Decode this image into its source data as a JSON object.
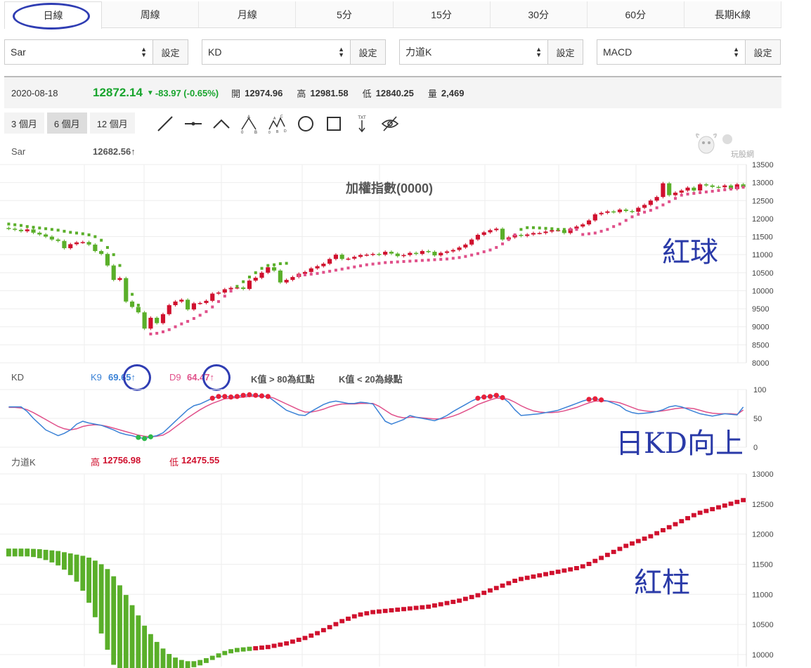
{
  "tabs": [
    "日線",
    "周線",
    "月線",
    "5分",
    "15分",
    "30分",
    "60分",
    "長期K線"
  ],
  "selectors": [
    {
      "value": "Sar",
      "button": "設定"
    },
    {
      "value": "KD",
      "button": "設定"
    },
    {
      "value": "力道K",
      "button": "設定"
    },
    {
      "value": "MACD",
      "button": "設定"
    }
  ],
  "info": {
    "date": "2020-08-18",
    "price": "12872.14",
    "change": "-83.97 (-0.65%)",
    "open_label": "開",
    "open": "12974.96",
    "high_label": "高",
    "high": "12981.58",
    "low_label": "低",
    "low": "12840.25",
    "vol_label": "量",
    "vol": "2,469",
    "down_color": "#19a52e"
  },
  "ranges": [
    "3 個月",
    "6 個月",
    "12 個月"
  ],
  "tools": [
    "line-tool-icon",
    "segment-tool-icon",
    "angle-tool-icon",
    "abc-pattern-icon",
    "abcd-pattern-icon",
    "circle-tool-icon",
    "rectangle-tool-icon",
    "text-tool-icon",
    "hide-icon"
  ],
  "watermark": "玩股網",
  "sar_panel": {
    "name": "Sar",
    "value": "12682.56↑",
    "title": "加權指數(0000)",
    "annotation": "紅球"
  },
  "kd_panel": {
    "name": "KD",
    "k_label": "K9",
    "k_value": "69.65↑",
    "d_label": "D9",
    "d_value": "64.47↑",
    "note1": "K值 > 80為紅點",
    "note2": "K值 < 20為綠點",
    "annotation": "日KD向上"
  },
  "force_panel": {
    "name": "力道K",
    "high_label": "高",
    "high": "12756.98",
    "low_label": "低",
    "low": "12475.55",
    "annotation": "紅柱"
  },
  "colors": {
    "up": "#d0102e",
    "down": "#5aaf2a",
    "k_line": "#3b82d6",
    "d_line": "#e0508a",
    "annotation": "#2a3aa8"
  },
  "chart_data": [
    {
      "type": "candlestick",
      "title": "加權指數(0000)",
      "ylim": [
        8000,
        13500
      ],
      "yticks": [
        13500,
        13000,
        12500,
        12000,
        11500,
        11000,
        10500,
        10000,
        9500,
        9000,
        8500,
        8000
      ],
      "closes": [
        11720,
        11690,
        11650,
        11700,
        11610,
        11560,
        11500,
        11420,
        11380,
        11180,
        11290,
        11340,
        11350,
        11280,
        11100,
        11020,
        10700,
        10300,
        10350,
        9700,
        9550,
        9400,
        8950,
        9250,
        9100,
        9350,
        9600,
        9700,
        9750,
        9480,
        9650,
        9660,
        9720,
        9920,
        9950,
        10040,
        10080,
        10090,
        10050,
        10280,
        10360,
        10500,
        10650,
        10560,
        10230,
        10300,
        10380,
        10470,
        10520,
        10620,
        10680,
        10750,
        10880,
        11000,
        10880,
        10890,
        10940,
        10990,
        11000,
        11020,
        11000,
        11080,
        11030,
        10960,
        10990,
        11050,
        11020,
        11100,
        11080,
        10980,
        11050,
        11090,
        11130,
        11200,
        11280,
        11420,
        11550,
        11620,
        11680,
        11720,
        11420,
        11480,
        11550,
        11520,
        11560,
        11600,
        11600,
        11640,
        11680,
        11680,
        11600,
        11720,
        11780,
        11840,
        11950,
        12120,
        12160,
        12200,
        12180,
        12250,
        12210,
        12190,
        12300,
        12380,
        12500,
        12600,
        12980,
        12650,
        12720,
        12780,
        12860,
        12780,
        12950,
        12920,
        12880,
        12870,
        12920,
        12820,
        12950,
        12872
      ],
      "sar": [
        11850,
        11830,
        11810,
        11780,
        11760,
        11740,
        11720,
        11700,
        11680,
        11650,
        11620,
        11600,
        11580,
        11550,
        11500,
        11400,
        11200,
        11000,
        10700,
        10300,
        9900,
        9600,
        null,
        8800,
        8820,
        8860,
        8920,
        9000,
        9080,
        9150,
        9230,
        9320,
        9420,
        9550,
        9700,
        9850,
        9990,
        10120,
        10250,
        10380,
        10500,
        10620,
        10700,
        10720,
        10750,
        10760,
        null,
        10420,
        10440,
        10460,
        10480,
        10510,
        10540,
        10570,
        10600,
        10630,
        10660,
        10690,
        10720,
        10740,
        10760,
        10780,
        10790,
        10800,
        10810,
        10820,
        10830,
        10840,
        10850,
        10860,
        10870,
        10880,
        10900,
        10920,
        10950,
        10990,
        11030,
        11080,
        11130,
        11200,
        11300,
        11420,
        11550,
        11700,
        11750,
        11750,
        11740,
        11730,
        11720,
        11700,
        11700,
        11700,
        11700,
        11560,
        11580,
        11600,
        11650,
        11700,
        11780,
        11850,
        11950,
        12050,
        12120,
        12180,
        12230,
        12300,
        12380,
        12470,
        12560,
        12650,
        12680,
        12700,
        12720,
        12740,
        12760,
        12780,
        12800,
        12820,
        12850,
        12870
      ]
    },
    {
      "type": "line",
      "ylim": [
        0,
        100
      ],
      "yticks": [
        100,
        50,
        0
      ],
      "series": [
        {
          "name": "K9",
          "values": [
            70,
            70,
            70,
            62,
            50,
            40,
            30,
            25,
            20,
            24,
            30,
            40,
            45,
            42,
            40,
            38,
            34,
            30,
            25,
            22,
            20,
            17,
            15,
            18,
            20,
            25,
            35,
            45,
            55,
            65,
            72,
            75,
            80,
            85,
            88,
            88,
            87,
            88,
            90,
            91,
            90,
            89,
            88,
            80,
            72,
            64,
            60,
            56,
            55,
            62,
            68,
            74,
            78,
            80,
            78,
            76,
            76,
            78,
            77,
            75,
            60,
            45,
            40,
            44,
            48,
            55,
            52,
            50,
            48,
            46,
            50,
            55,
            62,
            68,
            74,
            80,
            85,
            87,
            88,
            90,
            86,
            78,
            65,
            55,
            56,
            57,
            58,
            60,
            62,
            64,
            68,
            72,
            76,
            80,
            83,
            84,
            82,
            80,
            76,
            72,
            64,
            60,
            58,
            59,
            60,
            62,
            65,
            70,
            72,
            70,
            66,
            62,
            58,
            56,
            54,
            56,
            58,
            57,
            56,
            69.65
          ]
        },
        {
          "name": "D9",
          "values": [
            69,
            69,
            68,
            65,
            60,
            54,
            48,
            42,
            36,
            32,
            30,
            32,
            36,
            38,
            39,
            38,
            36,
            33,
            30,
            27,
            24,
            21,
            19,
            18,
            19,
            21,
            27,
            35,
            43,
            51,
            58,
            65,
            71,
            76,
            80,
            84,
            85,
            86,
            87,
            88,
            88,
            88,
            88,
            85,
            80,
            75,
            70,
            65,
            61,
            61,
            63,
            66,
            70,
            73,
            75,
            75,
            75,
            76,
            76,
            76,
            71,
            64,
            57,
            53,
            51,
            52,
            52,
            51,
            50,
            49,
            49,
            51,
            54,
            58,
            63,
            68,
            74,
            78,
            82,
            85,
            85,
            83,
            78,
            72,
            67,
            63,
            61,
            60,
            60,
            61,
            63,
            66,
            69,
            73,
            77,
            80,
            80,
            80,
            79,
            77,
            73,
            69,
            65,
            63,
            62,
            62,
            63,
            65,
            67,
            68,
            68,
            67,
            64,
            61,
            59,
            58,
            58,
            58,
            57,
            64.47
          ]
        }
      ]
    },
    {
      "type": "bar",
      "ylim": [
        9800,
        13000
      ],
      "yticks": [
        13000,
        12500,
        12000,
        11500,
        11000,
        10500,
        10000
      ],
      "values": [
        11760,
        11760,
        11760,
        11760,
        11755,
        11750,
        11740,
        11730,
        11720,
        11700,
        11680,
        11660,
        11640,
        11610,
        11560,
        11500,
        11420,
        11300,
        11150,
        10990,
        10820,
        10650,
        10480,
        10340,
        10210,
        10100,
        10010,
        9950,
        9910,
        9890,
        9890,
        9910,
        9940,
        9980,
        10020,
        10060,
        10090,
        10110,
        10120,
        10130,
        10140,
        10150,
        10160,
        10180,
        10200,
        10220,
        10250,
        10280,
        10310,
        10350,
        10390,
        10440,
        10490,
        10540,
        10590,
        10630,
        10670,
        10700,
        10720,
        10740,
        10750,
        10760,
        10770,
        10780,
        10790,
        10800,
        10810,
        10820,
        10830,
        10850,
        10870,
        10890,
        10910,
        10930,
        10960,
        10990,
        11020,
        11060,
        11100,
        11140,
        11180,
        11220,
        11260,
        11290,
        11310,
        11330,
        11350,
        11370,
        11390,
        11410,
        11430,
        11450,
        11470,
        11500,
        11540,
        11590,
        11640,
        11690,
        11740,
        11790,
        11840,
        11880,
        11920,
        11960,
        12000,
        12050,
        12100,
        12150,
        12200,
        12250,
        12300,
        12350,
        12390,
        12420,
        12450,
        12480,
        12510,
        12540,
        12570,
        12600
      ],
      "lows": [
        11700,
        11700,
        11700,
        11700,
        11690,
        11670,
        11640,
        11600,
        11550,
        11480,
        11390,
        11280,
        11130,
        10930,
        10690,
        10420,
        10150,
        9900,
        9800,
        9800,
        9800,
        9800,
        9800,
        9800,
        9800,
        9800,
        9800,
        9800,
        9810,
        9830,
        9860,
        9890,
        9930,
        9980,
        10020,
        10060,
        10090,
        10110,
        10120,
        10130,
        10140,
        10150,
        10160,
        10180,
        10200,
        10220,
        10250,
        10280,
        10310,
        10350,
        10390,
        10440,
        10490,
        10540,
        10590,
        10630,
        10670,
        10700,
        10720,
        10740,
        10750,
        10760,
        10770,
        10780,
        10790,
        10800,
        10810,
        10820,
        10830,
        10850,
        10870,
        10890,
        10910,
        10930,
        10960,
        10990,
        11020,
        11060,
        11100,
        11140,
        11180,
        11220,
        11260,
        11290,
        11310,
        11330,
        11350,
        11370,
        11390,
        11410,
        11430,
        11450,
        11470,
        11500,
        11540,
        11590,
        11640,
        11690,
        11740,
        11790,
        11840,
        11880,
        11920,
        11960,
        12000,
        12050,
        12100,
        12150,
        12200,
        12250,
        12300,
        12350,
        12390,
        12420,
        12450,
        12480,
        12510,
        12540,
        12570,
        12600
      ]
    }
  ]
}
